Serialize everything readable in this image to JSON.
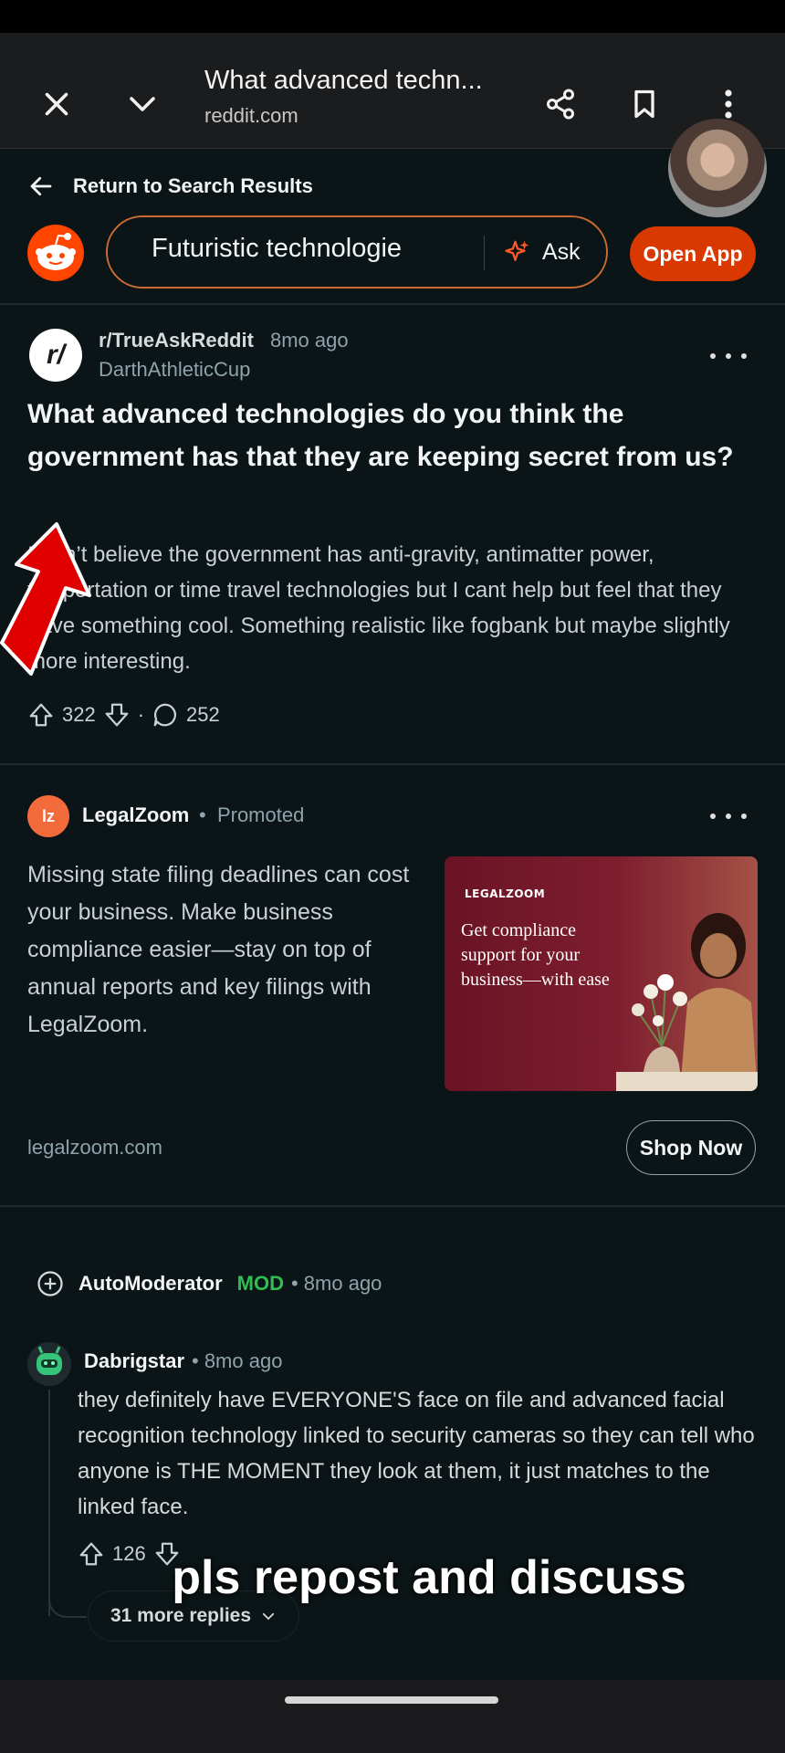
{
  "browser": {
    "tab_title": "What advanced techn...",
    "url": "reddit.com"
  },
  "header": {
    "return_label": "Return to Search Results",
    "search_value": "Futuristic technologie",
    "ask_label": "Ask",
    "open_app_label": "Open App"
  },
  "post": {
    "subreddit": "r/TrueAskReddit",
    "time": "8mo ago",
    "author": "DarthAthleticCup",
    "title": "What advanced technologies do you think the government has that they are keeping secret from us?",
    "body": "I don’t believe the government has anti-gravity, antimatter power, teleportation or time travel technologies but I cant help but feel that they have something cool. Something realistic like fogbank but maybe slightly more interesting.",
    "upvotes": "322",
    "separator": "·",
    "comments": "252"
  },
  "ad": {
    "advertiser": "LegalZoom",
    "dot": "•",
    "promoted_label": "Promoted",
    "logo_text": "lz",
    "text": "Missing state filing deadlines can cost your business. Make business compliance easier—stay on top of annual reports and key filings with LegalZoom.",
    "image_brand": "LEGALZOOM",
    "image_caption": "Get compliance support for your business—with ease",
    "domain": "legalzoom.com",
    "cta_label": "Shop Now"
  },
  "automod": {
    "name": "AutoModerator",
    "badge": "MOD",
    "time": "• 8mo ago"
  },
  "comment": {
    "author": "Dabrigstar",
    "time": "• 8mo ago",
    "body": "they definitely have EVERYONE'S face on file and advanced facial recognition technology linked to security cameras so they can tell who anyone is THE MOMENT they look at them, it just matches to the linked face.",
    "upvotes": "126",
    "more_replies_label": "31 more replies"
  },
  "overlay": {
    "caption": "pls repost and discuss"
  },
  "colors": {
    "background": "#0b1416",
    "accent": "#d93900",
    "mod_green": "#2fbf50",
    "arrow_red": "#e00000"
  },
  "icons": [
    "close-icon",
    "chevron-down-icon",
    "share-icon",
    "bookmark-icon",
    "overflow-menu-icon",
    "back-arrow-icon",
    "reddit-snoo-icon",
    "sparkle-icon",
    "upvote-icon",
    "downvote-icon",
    "comment-icon",
    "expand-plus-icon"
  ]
}
